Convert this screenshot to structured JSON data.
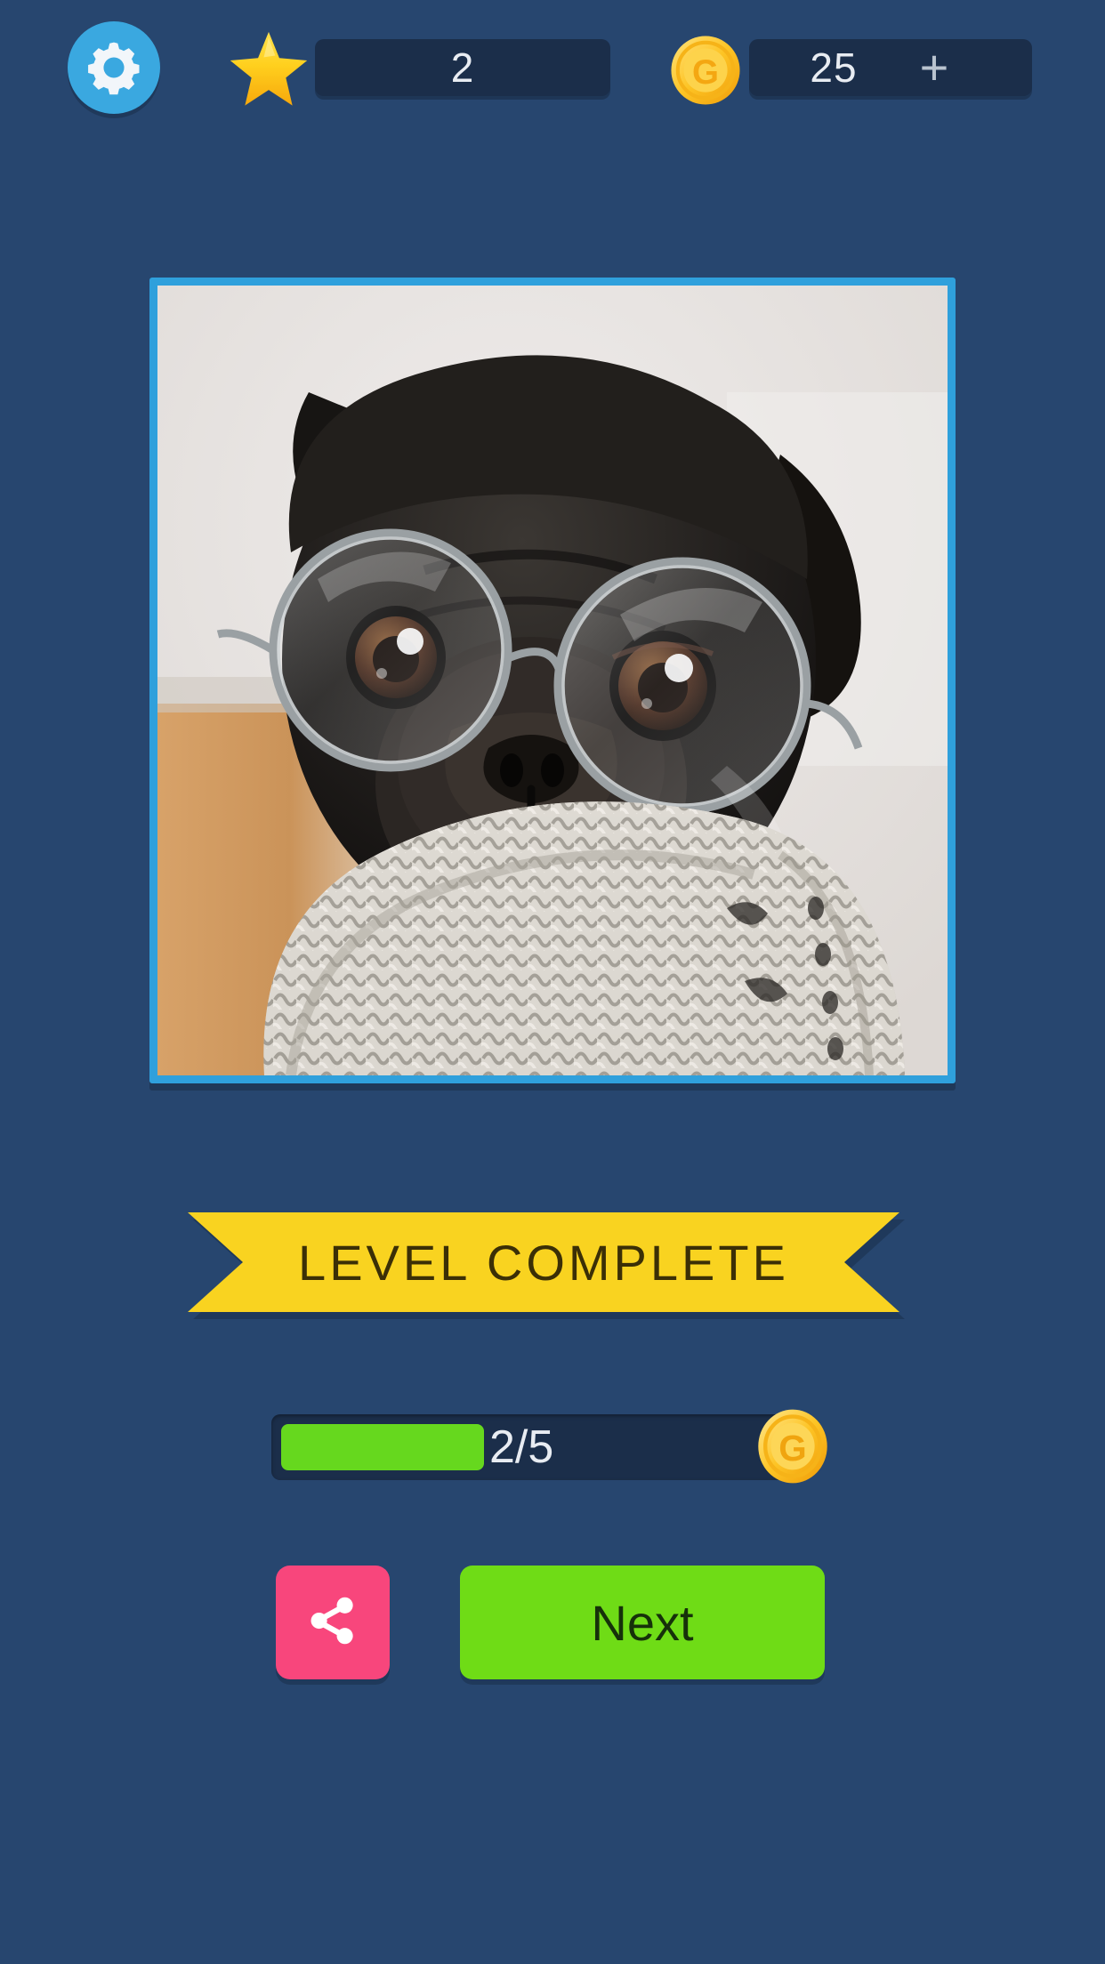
{
  "app": {
    "background_color": "#27466f",
    "accent_blue": "#3aa8e0",
    "accent_yellow": "#f9d320",
    "accent_green": "#6fdc16",
    "accent_pink": "#f8467c"
  },
  "header": {
    "settings_button": {
      "icon": "gear-icon",
      "label": "Settings"
    },
    "stars": {
      "icon": "star-icon",
      "value": "2"
    },
    "coins": {
      "icon": "coin-icon",
      "value": "25",
      "add_label": "+"
    }
  },
  "puzzle": {
    "image_alt": "Black pug wearing round wire-frame glasses and a knitted scarf",
    "frame_color": "#2fa0dc"
  },
  "banner": {
    "text": "LEVEL COMPLETE"
  },
  "progress": {
    "label": "2/5",
    "current": 2,
    "total": 5,
    "fill_color": "#66d81e",
    "reward_icon": "coin-icon"
  },
  "actions": {
    "share": {
      "icon": "share-icon",
      "label": "Share"
    },
    "next": {
      "label": "Next"
    }
  }
}
